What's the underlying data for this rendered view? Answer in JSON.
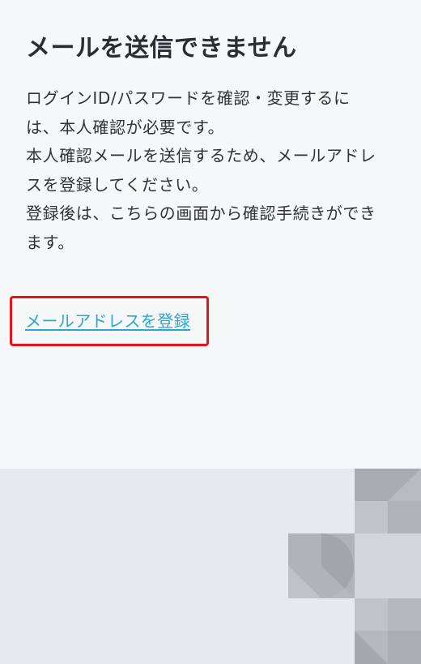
{
  "page": {
    "title": "メールを送信できません",
    "description_lines": [
      "ログインID/パスワードを確認・変更するに",
      "は、本人確認が必要です。",
      "本人確認メールを送信するため、メールアドレ",
      "スを登録してください。",
      "登録後は、こちらの画面から確認手続きができ",
      "ます。"
    ],
    "register_link_label": "メールアドレスを登録"
  },
  "colors": {
    "background": "#f6f7f9",
    "title_text": "#2a2e33",
    "body_text": "#2f3338",
    "link": "#2aa5d6",
    "highlight_border": "#e5161b",
    "footer_background": "#e8e9ec",
    "pattern_gray_light": "#c1c3c8",
    "pattern_gray_mid": "#b3b5ba",
    "pattern_gray_dark": "#a6a8ad"
  },
  "icons": {
    "footer_pattern": "geometric-tile-pattern"
  }
}
